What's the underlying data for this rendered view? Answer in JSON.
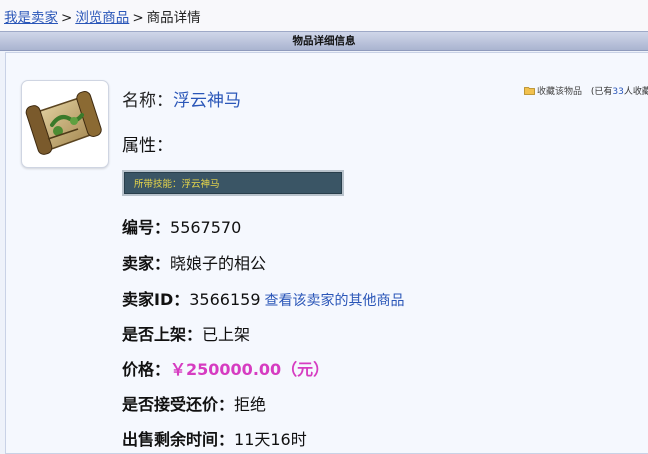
{
  "breadcrumb": {
    "seller": "我是卖家",
    "browse": "浏览商品",
    "current": "商品详情",
    "separator": ">"
  },
  "section_header": "物品详细信息",
  "item": {
    "name_label": "名称：",
    "name": "浮云神马",
    "attributes_label": "属性：",
    "skill_text": "所带技能：浮云神马",
    "favorite_link": "收藏该物品",
    "favorite_prefix": "(已有",
    "favorite_count": "33",
    "favorite_suffix": "人收藏)",
    "number_label": "编号：",
    "number": "5567570",
    "seller_label": "卖家：",
    "seller": "晓娘子的相公",
    "seller_id_label": "卖家ID：",
    "seller_id": "3566159",
    "seller_other_link": "查看该卖家的其他商品",
    "listed_label": "是否上架：",
    "listed": "已上架",
    "price_label": "价格：",
    "price": "￥250000.00（元）",
    "bargain_label": "是否接受还价：",
    "bargain": "拒绝",
    "remaining_label": "出售剩余时间：",
    "remaining": "11天16时"
  },
  "colors": {
    "link": "#2a56b8",
    "price": "#d63cc1",
    "skill_box_bg": "#3a5565",
    "skill_text": "#e9d84a"
  }
}
